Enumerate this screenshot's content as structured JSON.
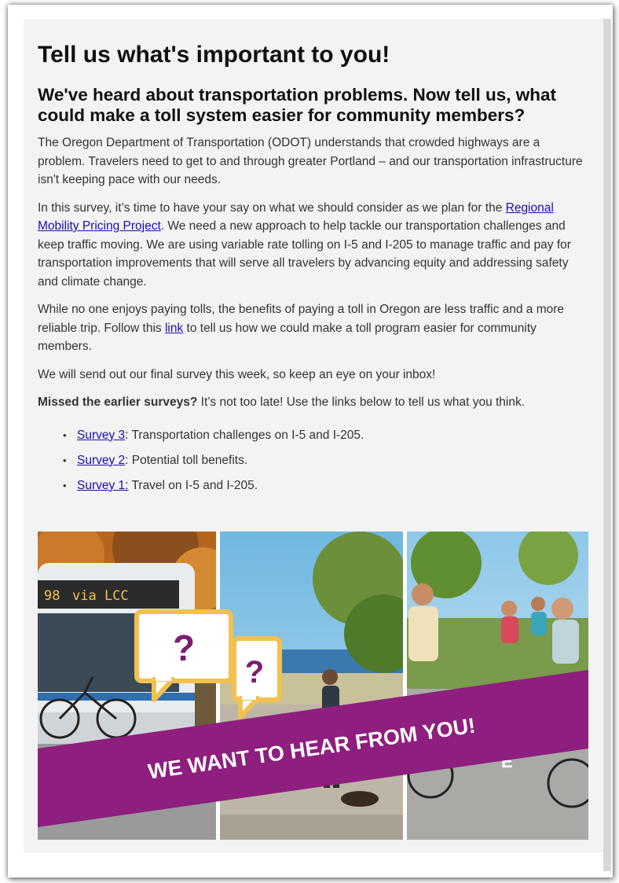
{
  "title": "Tell us what's important to you!",
  "subtitle": "We've heard about transportation problems. Now tell us, what could make a toll system easier for community members?",
  "paragraph1": "The Oregon Department of Transportation (ODOT) understands that crowded highways are a problem. Travelers need to get to and through greater Portland – and our transportation infrastructure isn't keeping pace with our needs.",
  "paragraph2": {
    "before": "In this survey, it’s time to have your say on what we should consider as we plan for the ",
    "link": "Regional Mobility Pricing Project",
    "after": ". We need a new approach to help tackle our transportation challenges and keep traffic moving. We are using variable rate tolling on I-5 and I-205 to manage traffic and pay for transportation improvements that will serve all travelers by advancing equity and addressing safety and climate change."
  },
  "paragraph3": {
    "before": "While no one enjoys paying tolls, the benefits of paying a toll in Oregon are less traffic and a more reliable trip. Follow this ",
    "link": "link",
    "after": " to tell us how we could make a toll program easier for community members."
  },
  "paragraph4": "We will send out our final survey this week, so keep an eye on your inbox!",
  "paragraph5": {
    "bold": "Missed the earlier surveys?",
    "rest": " It’s not too late! Use the links below to tell us what you think."
  },
  "surveys": [
    {
      "link": "Survey 3",
      "text": ": Transportation challenges on I-5 and I-205."
    },
    {
      "link": "Survey 2",
      "text": ": Potential toll benefits."
    },
    {
      "link": "Survey 1:",
      "text": " Travel on I-5 and I-205."
    }
  ],
  "banner": {
    "bus_sign": "via LCC",
    "bus_number": "98",
    "question_mark": "?",
    "slogan": "WE WANT TO HEAR FROM YOU!",
    "bike_lane_text": "E",
    "colors": {
      "magenta": "#8e1f7e",
      "bubble_gold": "#f2c14e",
      "question_purple": "#7b1e6f"
    }
  }
}
